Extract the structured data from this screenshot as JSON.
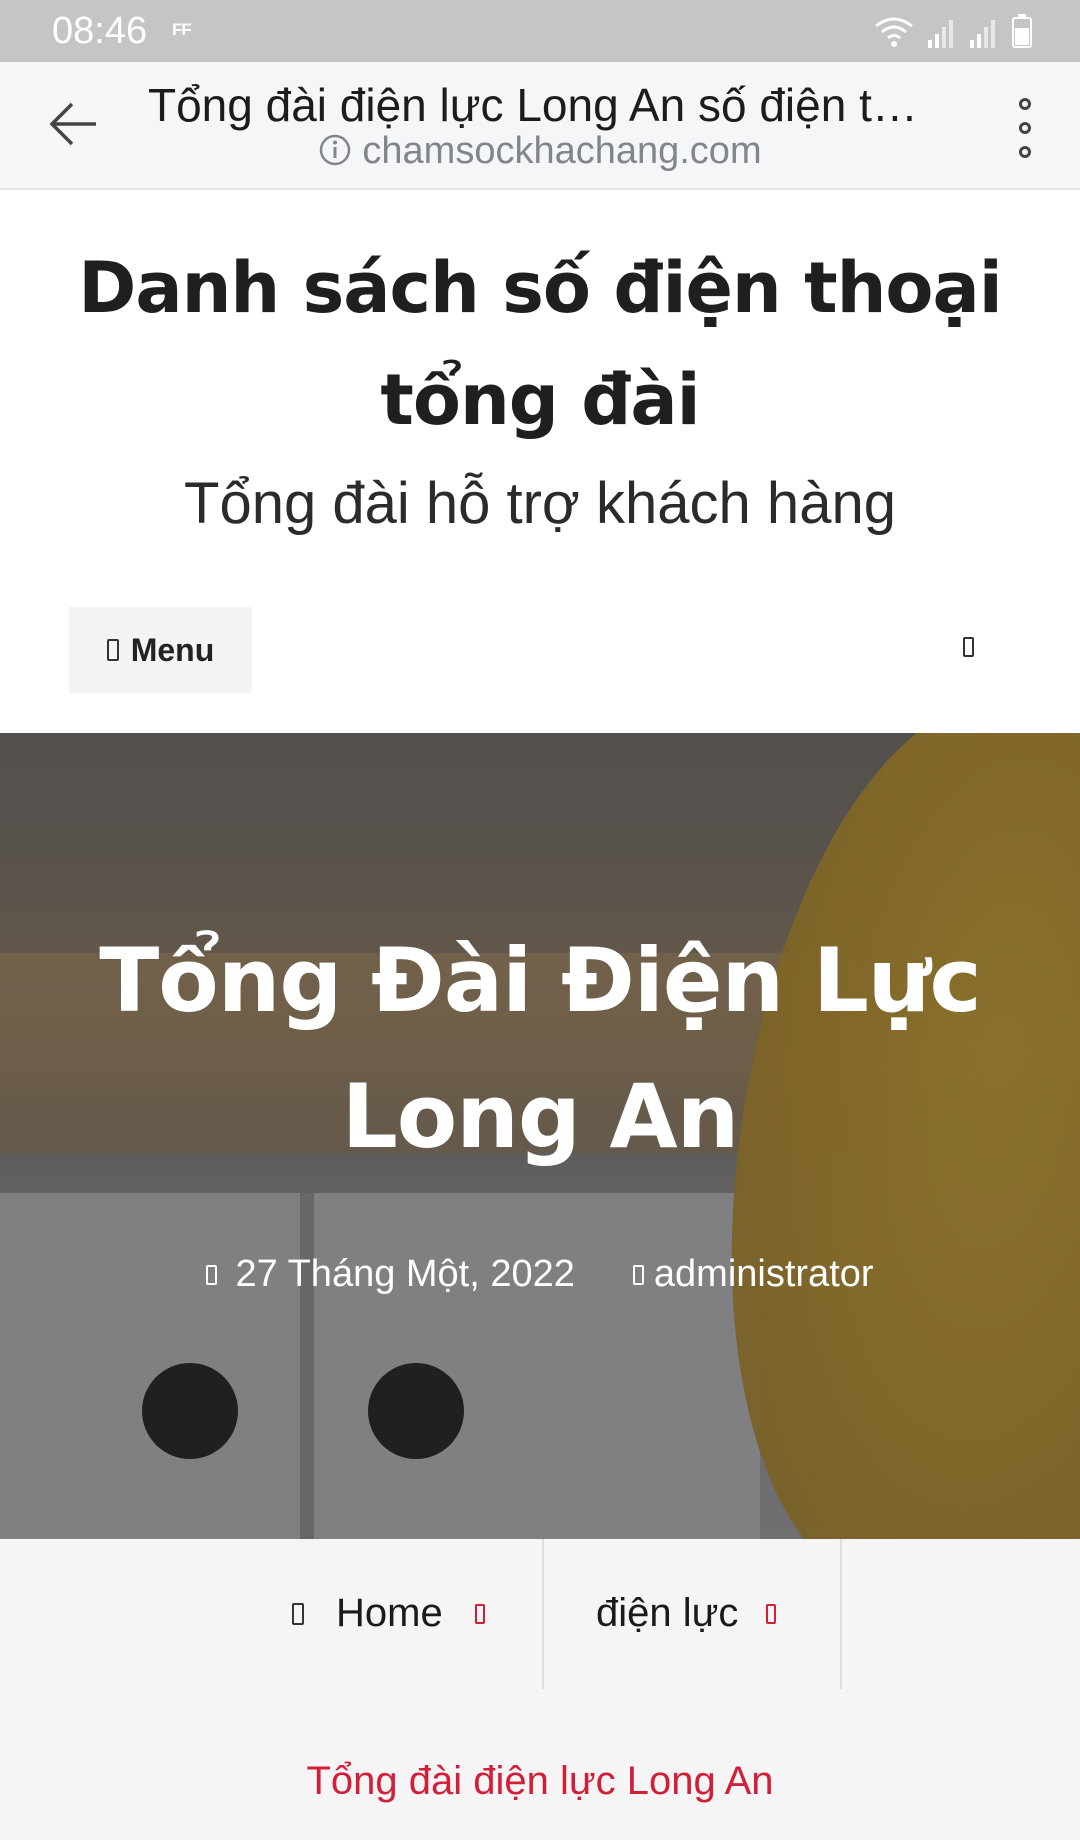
{
  "status_bar": {
    "time": "08:46",
    "indicator": "FF",
    "icons": [
      "wifi-icon",
      "signal-icon",
      "signal-icon",
      "battery-icon"
    ]
  },
  "browser": {
    "tab_title": "Tổng đài điện lực Long An số điện thoại",
    "url": "chamsockhachang.com",
    "icons": [
      "back-arrow-icon",
      "info-icon",
      "more-vertical-icon"
    ]
  },
  "site": {
    "title": "Danh sách số điện thoại tổng đài",
    "tagline": "Tổng đài hỗ trợ khách hàng",
    "menu_label": "Menu",
    "icons": [
      "menu-icon",
      "search-icon"
    ]
  },
  "post": {
    "title": "Tổng Đài Điện Lực Long An",
    "date": "27 Tháng Một, 2022",
    "author": "administrator",
    "icons": [
      "calendar-icon",
      "user-icon"
    ]
  },
  "breadcrumb": {
    "items": [
      "Home",
      "điện lực"
    ],
    "current": "Tổng đài điện lực Long An",
    "accent_color": "#d31e3a",
    "icons": [
      "home-icon",
      "chevron-right-icon"
    ]
  }
}
